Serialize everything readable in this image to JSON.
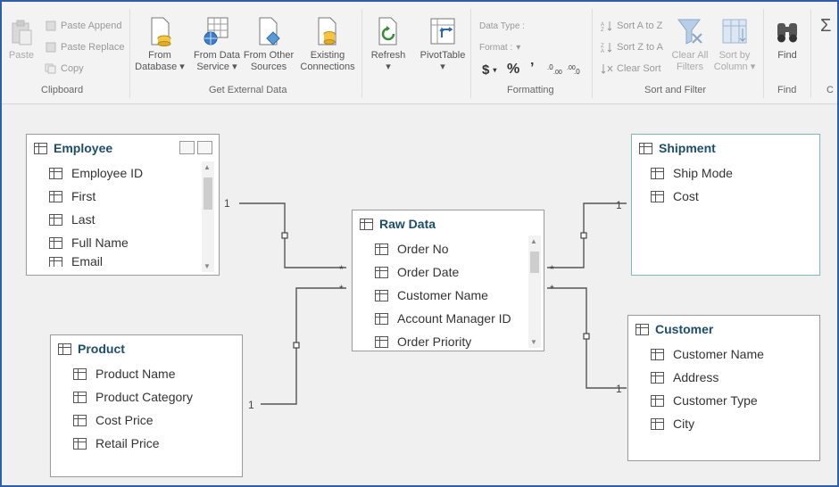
{
  "ribbon": {
    "clipboard": {
      "group_label": "Clipboard",
      "paste": "Paste",
      "paste_append": "Paste Append",
      "paste_replace": "Paste Replace",
      "copy": "Copy"
    },
    "external": {
      "group_label": "Get External Data",
      "from_database_1": "From",
      "from_database_2": "Database",
      "from_data_service_1": "From Data",
      "from_data_service_2": "Service",
      "from_other_1": "From Other",
      "from_other_2": "Sources",
      "existing_1": "Existing",
      "existing_2": "Connections"
    },
    "refresh": "Refresh",
    "pivottable": "PivotTable",
    "formatting": {
      "group_label": "Formatting",
      "data_type": "Data Type :",
      "format": "Format :",
      "currency": "$",
      "percent": "%",
      "comma": "’"
    },
    "sort": {
      "group_label": "Sort and Filter",
      "sort_az": "Sort A to Z",
      "sort_za": "Sort Z to A",
      "clear_sort": "Clear Sort",
      "clear_filters_1": "Clear All",
      "clear_filters_2": "Filters",
      "sort_by_1": "Sort by",
      "sort_by_2": "Column"
    },
    "find": {
      "group_label": "Find",
      "find": "Find"
    },
    "sigma": "Σ",
    "c_label": "C"
  },
  "tables": {
    "employee": {
      "title": "Employee",
      "columns": [
        "Employee ID",
        "First",
        "Last",
        "Full Name",
        "Email"
      ]
    },
    "raw": {
      "title": "Raw Data",
      "columns": [
        "Order No",
        "Order Date",
        "Customer Name",
        "Account Manager ID",
        "Order Priority"
      ]
    },
    "shipment": {
      "title": "Shipment",
      "columns": [
        "Ship Mode",
        "Cost"
      ]
    },
    "product": {
      "title": "Product",
      "columns": [
        "Product Name",
        "Product Category",
        "Cost Price",
        "Retail Price"
      ]
    },
    "customer": {
      "title": "Customer",
      "columns": [
        "Customer Name",
        "Address",
        "Customer Type",
        "City"
      ]
    }
  },
  "relationships": {
    "one": "1",
    "many": "*"
  }
}
